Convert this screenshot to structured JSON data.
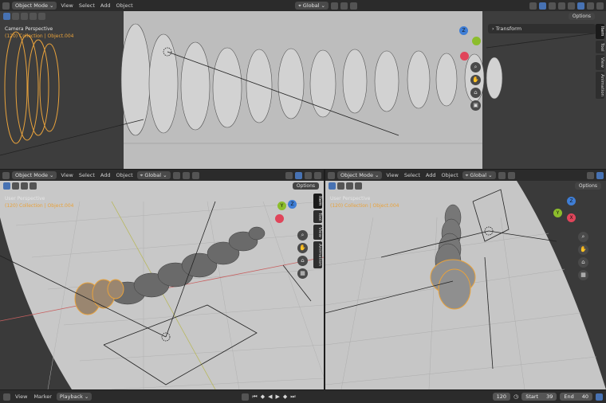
{
  "top_viewport": {
    "mode": "Object Mode",
    "menus": [
      "View",
      "Select",
      "Add",
      "Object"
    ],
    "transform_orientation": "Global",
    "options_label": "Options",
    "view_name": "Camera Perspective",
    "collection_info": "(120) Collection | Object.004",
    "panel_title": "Transform",
    "tabs": [
      "Item",
      "Tool",
      "View",
      "Animation"
    ]
  },
  "bottom_left_viewport": {
    "mode": "Object Mode",
    "menus": [
      "View",
      "Select",
      "Add",
      "Object"
    ],
    "transform_orientation": "Global",
    "options_label": "Options",
    "view_name": "User Perspective",
    "collection_info": "(120) Collection | Object.004",
    "tabs": [
      "Item",
      "Tool",
      "View",
      "Animation"
    ]
  },
  "bottom_right_viewport": {
    "mode": "Object Mode",
    "menus": [
      "View",
      "Select",
      "Add",
      "Object"
    ],
    "transform_orientation": "Global",
    "options_label": "Options",
    "view_name": "User Perspective",
    "collection_info": "(120) Collection | Object.004",
    "tabs": [
      "Item",
      "Tool",
      "View",
      "Animation"
    ]
  },
  "gizmo": {
    "x": "X",
    "y": "Y",
    "z": "Z"
  },
  "timeline": {
    "menus": [
      "View",
      "Marker",
      "Playback"
    ],
    "current_frame": "120",
    "start_label": "Start",
    "start_value": "39",
    "end_label": "End",
    "end_value": "40"
  },
  "colors": {
    "selection": "#e8a23c",
    "accent": "#4772b3",
    "x_axis": "#e0455a",
    "y_axis": "#8cbd2c",
    "z_axis": "#3f7ed6"
  }
}
